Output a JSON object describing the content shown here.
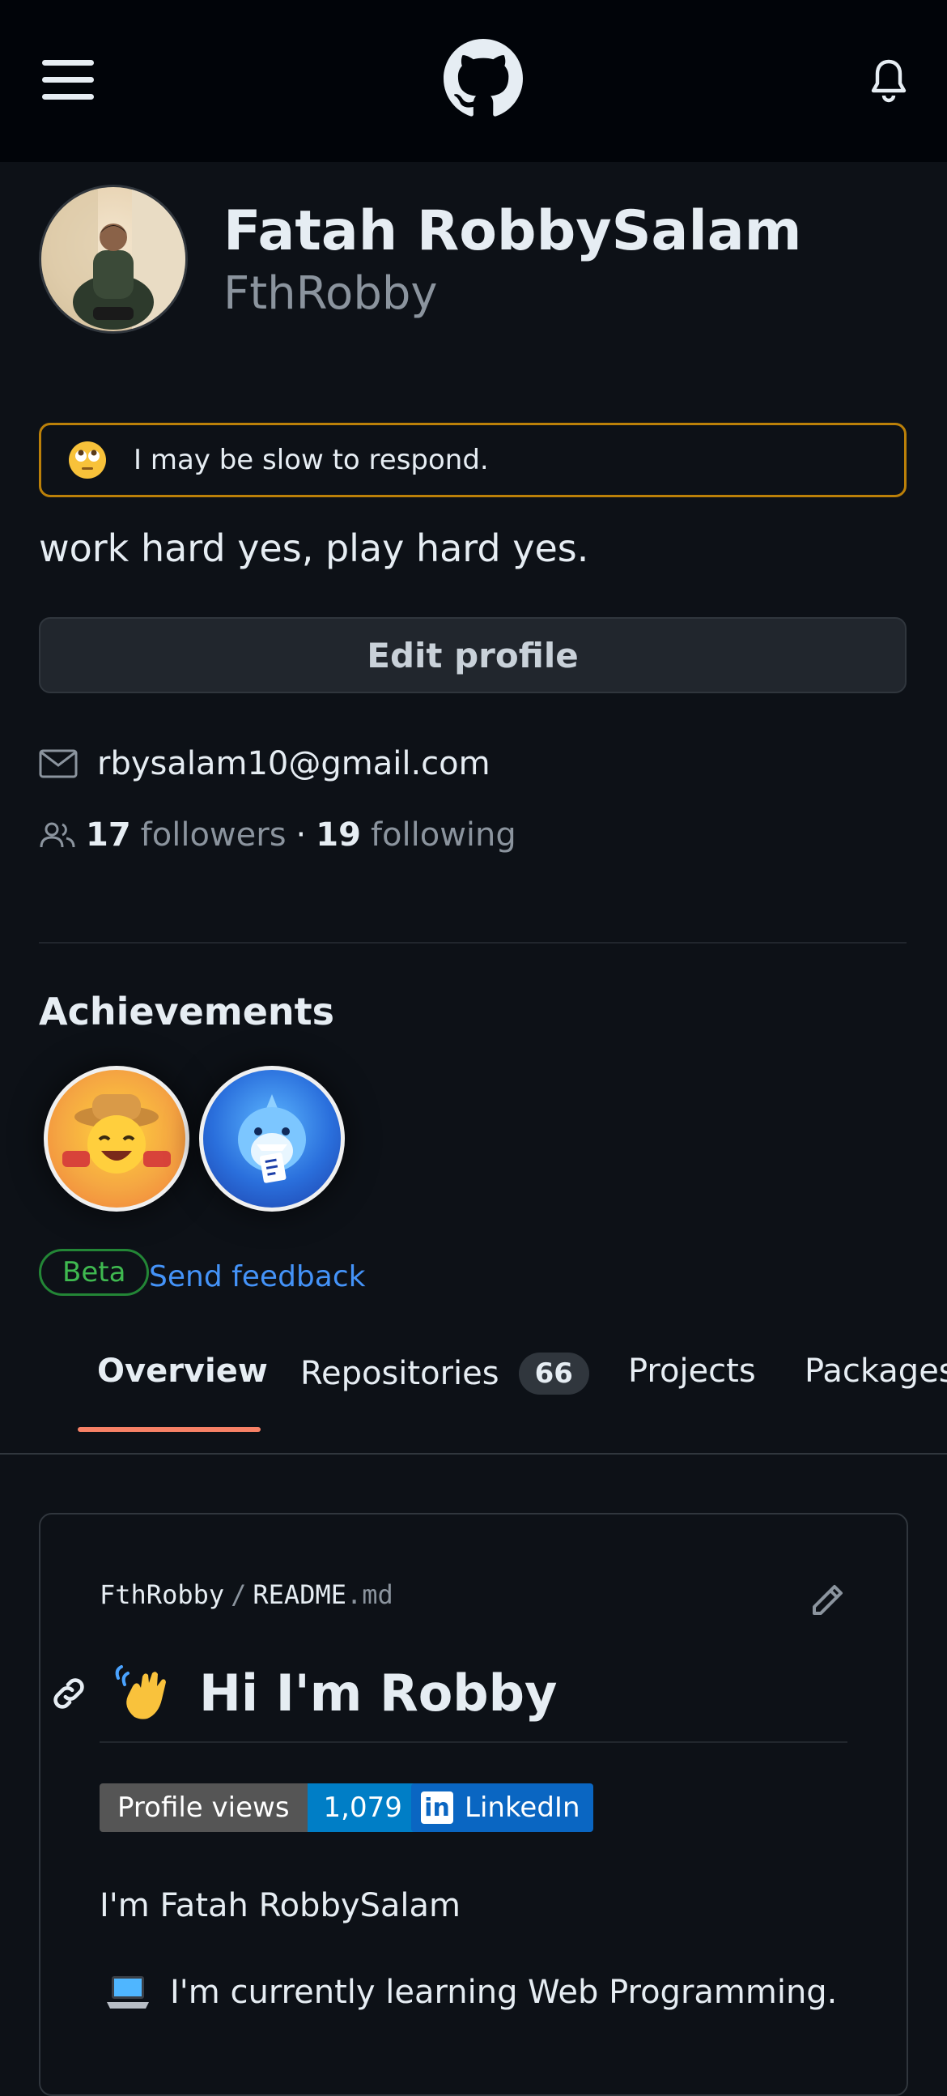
{
  "header": {
    "menu_icon": "hamburger-menu-icon",
    "logo_icon": "github-octocat-icon",
    "bell_icon": "bell-icon"
  },
  "profile": {
    "name": "Fatah RobbySalam",
    "login": "FthRobby",
    "status_text": "I may be slow to respond.",
    "status_emoji": "face-with-rolling-eyes",
    "bio": "work hard yes, play hard yes.",
    "edit_label": "Edit profile",
    "email": "rbysalam10@gmail.com",
    "followers_count": "17",
    "followers_label": "followers",
    "separator": "·",
    "following_count": "19",
    "following_label": "following"
  },
  "achievements": {
    "title": "Achievements",
    "badges": [
      "pull-shark-achievement",
      "yolo-achievement"
    ],
    "beta_label": "Beta",
    "feedback_label": "Send feedback"
  },
  "tabs": [
    {
      "label": "Overview",
      "active": true
    },
    {
      "label": "Repositories",
      "count": "66"
    },
    {
      "label": "Projects"
    },
    {
      "label": "Packages"
    }
  ],
  "readme": {
    "owner": "FthRobby",
    "separator": "/",
    "file_base": "README",
    "file_ext": ".md",
    "heading": "Hi I'm Robby",
    "views_label": "Profile views",
    "views_count": "1,079",
    "linkedin_label": "LinkedIn",
    "intro": "I'm Fatah RobbySalam",
    "learning": "I'm currently learning Web Programming."
  },
  "colors": {
    "background": "#0d1117",
    "accent_link": "#4493f8",
    "tab_underline": "#f78166",
    "status_border": "#bb8009",
    "beta_green": "#3fb950"
  }
}
